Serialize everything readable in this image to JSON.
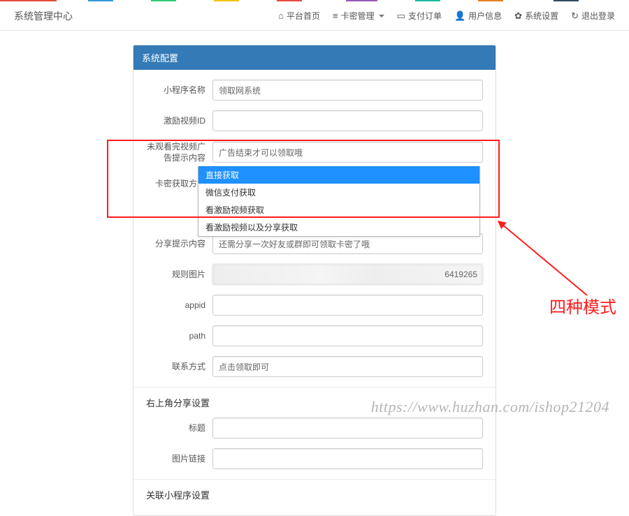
{
  "brand": "系统管理中心",
  "nav": {
    "home": "平台首页",
    "card": "卡密管理",
    "pay": "支付订单",
    "user": "用户信息",
    "settings": "系统设置",
    "logout": "退出登录"
  },
  "panel": {
    "title": "系统配置"
  },
  "form": {
    "app_name": {
      "label": "小程序名称",
      "value": "领取网系统"
    },
    "video_id": {
      "label": "激励视频ID",
      "value": ""
    },
    "unfinished_tip": {
      "label": "未观看完视频广告提示内容",
      "value": "广告结束才可以领取哦"
    },
    "get_mode": {
      "label": "卡密获取方式",
      "selected": "直接获取",
      "options": [
        "直接获取",
        "微信支付获取",
        "看激励视频获取",
        "看激励视频以及分享获取"
      ]
    },
    "share_tip": {
      "label": "分享提示内容",
      "value": "还需分享一次好友或群即可领取卡密了哦"
    },
    "rule_img": {
      "label": "规则图片",
      "tail": "6419265"
    },
    "appid": {
      "label": "appid",
      "value": ""
    },
    "path": {
      "label": "path",
      "value": ""
    },
    "contact": {
      "label": "联系方式",
      "value": "点击领取即可"
    }
  },
  "sections": {
    "share_corner": "右上角分享设置",
    "share_title": {
      "label": "标题",
      "value": ""
    },
    "share_img": {
      "label": "图片链接",
      "value": ""
    },
    "related_mp": "关联小程序设置"
  },
  "annotation": {
    "text": "四种模式"
  },
  "watermark": "https://www.huzhan.com/ishop21204"
}
